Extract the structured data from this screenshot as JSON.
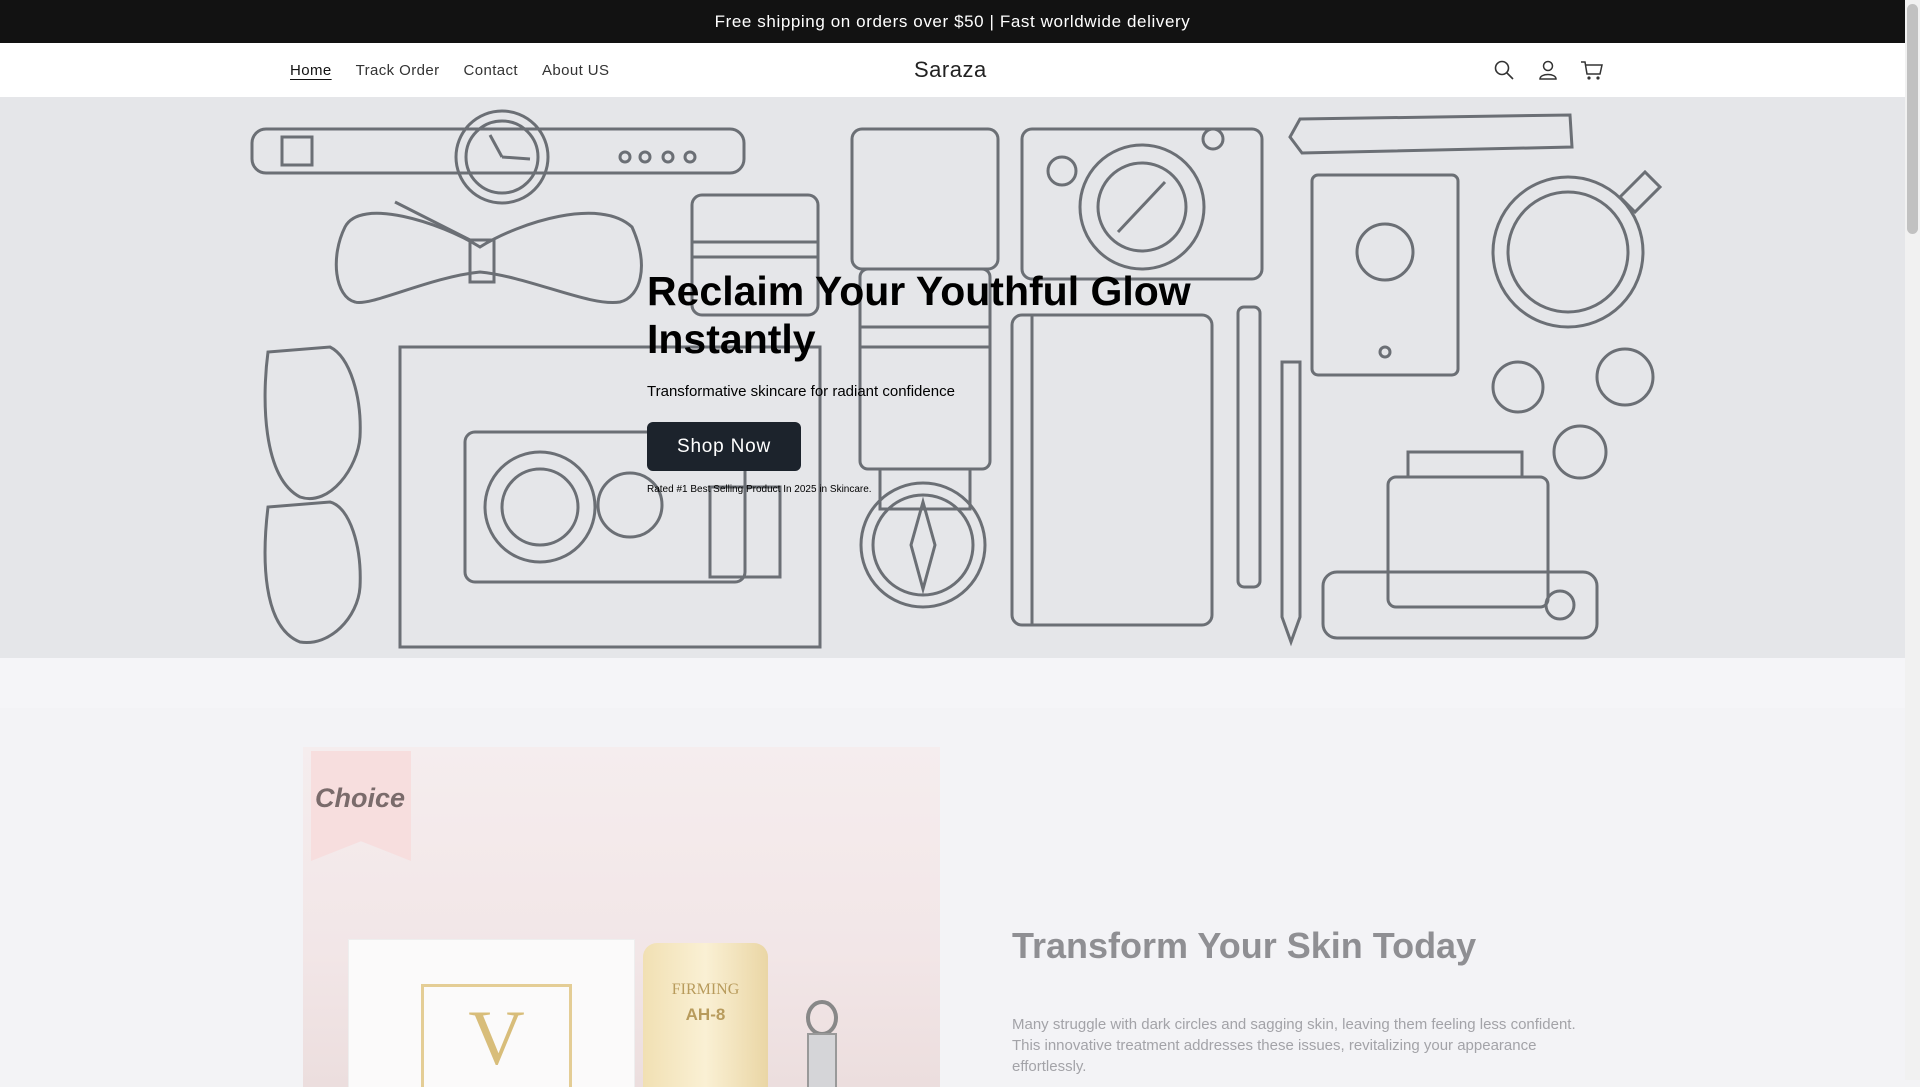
{
  "announcement": "Free shipping on orders over $50 | Fast worldwide delivery",
  "nav": {
    "items": [
      {
        "label": "Home",
        "active": true
      },
      {
        "label": "Track Order",
        "active": false
      },
      {
        "label": "Contact",
        "active": false
      },
      {
        "label": "About US",
        "active": false
      }
    ]
  },
  "brand": "Saraza",
  "header_icons": [
    "search-icon",
    "account-icon",
    "cart-icon"
  ],
  "hero": {
    "title": "Reclaim Your Youthful Glow Instantly",
    "subtitle": "Transformative skincare for radiant confidence",
    "cta": "Shop Now",
    "rating_note": "Rated #1 Best Selling Product In 2025 in Skincare."
  },
  "product_image": {
    "badge": "Choice",
    "box_letter": "V",
    "tube_label": "FIRMING",
    "tube_code": "AH-8"
  },
  "feature": {
    "title": "Transform Your Skin Today",
    "body": "Many struggle with dark circles and sagging skin, leaving them feeling less confident. This innovative treatment addresses these issues, revitalizing your appearance effortlessly."
  },
  "colors": {
    "announcement_bg": "#121212",
    "hero_bg": "#e5e6e9",
    "cta_bg": "#1c232c",
    "line_art": "#6b6f75"
  }
}
